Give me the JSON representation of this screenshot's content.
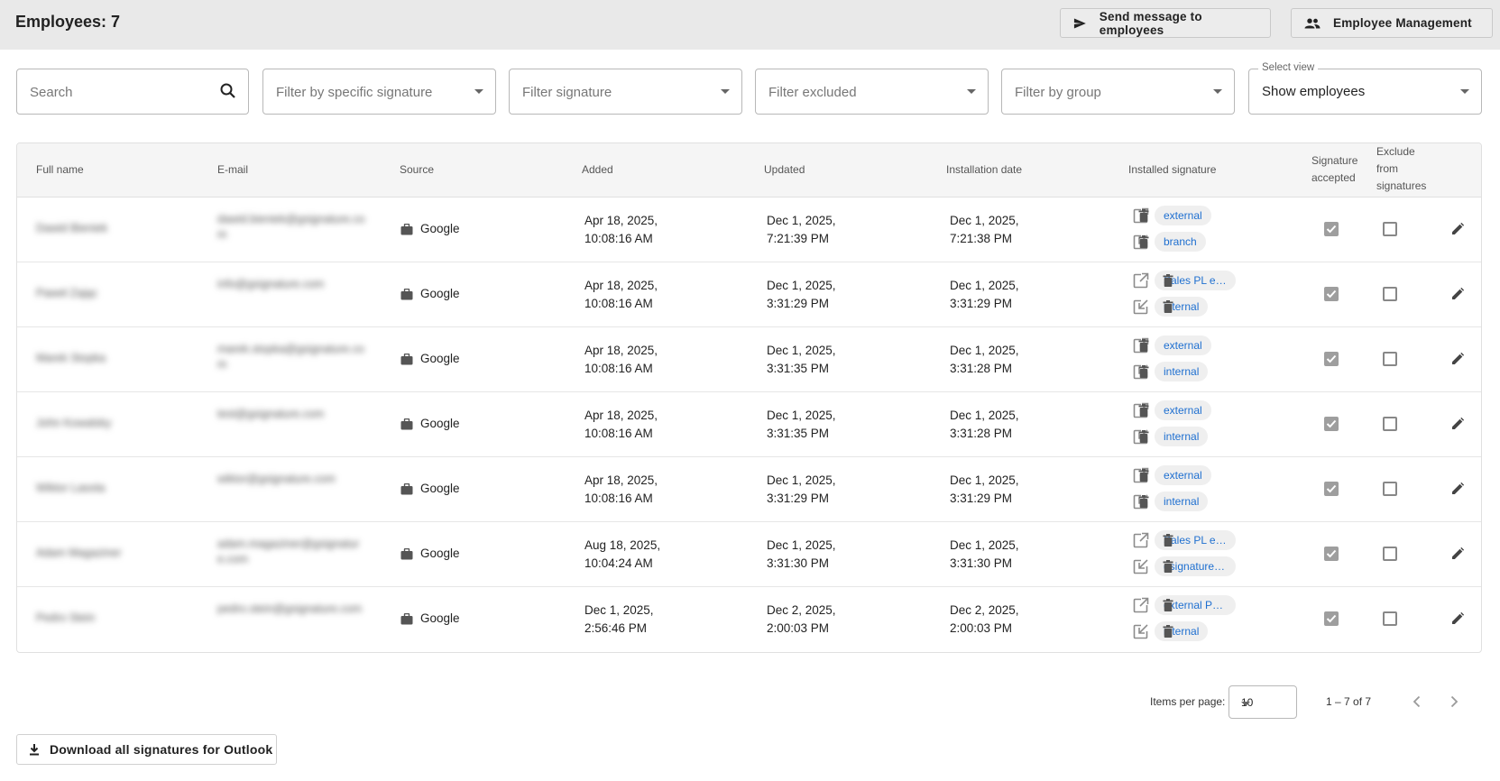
{
  "header": {
    "title": "Employees: 7",
    "send_label": "Send message to employees",
    "mgmt_label": "Employee Management"
  },
  "filters": {
    "search_placeholder": "Search",
    "specific_signature": "Filter by specific signature",
    "signature": "Filter signature",
    "excluded": "Filter excluded",
    "group": "Filter by group",
    "view_label": "Select view",
    "view_value": "Show employees"
  },
  "columns": {
    "full_name": "Full name",
    "email": "E-mail",
    "source": "Source",
    "added": "Added",
    "updated": "Updated",
    "installation_date": "Installation date",
    "installed_signature": "Installed signature",
    "signature_accepted_1": "Signature",
    "signature_accepted_2": "accepted",
    "exclude_1": "Exclude",
    "exclude_2": "from",
    "exclude_3": "signatures"
  },
  "rows": [
    {
      "name": "Dawid Bieniek",
      "email1": "dawid.bieniek@gsignature.co",
      "email2": "m",
      "source": "Google",
      "added1": "Apr 18, 2025,",
      "added2": "10:08:16 AM",
      "updated1": "Dec 1, 2025,",
      "updated2": "7:21:39 PM",
      "installed1": "Dec 1, 2025,",
      "installed2": "7:21:38 PM",
      "sig1": "external",
      "sig2": "branch",
      "accepted": true,
      "excluded": false
    },
    {
      "name": "Paweł Zając",
      "email1": "info@gsignature.com",
      "email2": "",
      "source": "Google",
      "added1": "Apr 18, 2025,",
      "added2": "10:08:16 AM",
      "updated1": "Dec 1, 2025,",
      "updated2": "3:31:29 PM",
      "installed1": "Dec 1, 2025,",
      "installed2": "3:31:29 PM",
      "sig1": "Sales PL ex...",
      "sig2": "internal",
      "accepted": true,
      "excluded": false
    },
    {
      "name": "Marek Stopka",
      "email1": "marek.stopka@gsignature.co",
      "email2": "m",
      "source": "Google",
      "added1": "Apr 18, 2025,",
      "added2": "10:08:16 AM",
      "updated1": "Dec 1, 2025,",
      "updated2": "3:31:35 PM",
      "installed1": "Dec 1, 2025,",
      "installed2": "3:31:28 PM",
      "sig1": "external",
      "sig2": "internal",
      "accepted": true,
      "excluded": false
    },
    {
      "name": "John Kowalsky",
      "email1": "test@gsignature.com",
      "email2": "",
      "source": "Google",
      "added1": "Apr 18, 2025,",
      "added2": "10:08:16 AM",
      "updated1": "Dec 1, 2025,",
      "updated2": "3:31:35 PM",
      "installed1": "Dec 1, 2025,",
      "installed2": "3:31:28 PM",
      "sig1": "external",
      "sig2": "internal",
      "accepted": true,
      "excluded": false
    },
    {
      "name": "Wiktor Lasota",
      "email1": "wiktor@gsignature.com",
      "email2": "",
      "source": "Google",
      "added1": "Apr 18, 2025,",
      "added2": "10:08:16 AM",
      "updated1": "Dec 1, 2025,",
      "updated2": "3:31:29 PM",
      "installed1": "Dec 1, 2025,",
      "installed2": "3:31:29 PM",
      "sig1": "external",
      "sig2": "internal",
      "accepted": true,
      "excluded": false
    },
    {
      "name": "Adam Magaziner",
      "email1": "adam.magaziner@gsignatur",
      "email2": "e.com",
      "source": "Google",
      "added1": "Aug 18, 2025,",
      "added2": "10:04:24 AM",
      "updated1": "Dec 1, 2025,",
      "updated2": "3:31:30 PM",
      "installed1": "Dec 1, 2025,",
      "installed2": "3:31:30 PM",
      "sig1": "Sales PL ex...",
      "sig2": "gsignaturec...",
      "accepted": true,
      "excluded": false
    },
    {
      "name": "Pedro Stein",
      "email1": "pedro.stein@gsignature.com",
      "email2": "",
      "source": "Google",
      "added1": "Dec 1, 2025,",
      "added2": "2:56:46 PM",
      "updated1": "Dec 2, 2025,",
      "updated2": "2:00:03 PM",
      "installed1": "Dec 2, 2025,",
      "installed2": "2:00:03 PM",
      "sig1": "external Pe...",
      "sig2": "internal",
      "accepted": true,
      "excluded": false
    }
  ],
  "pagination": {
    "items_label": "Items per page:",
    "items_value": "10",
    "range": "1 – 7 of 7"
  },
  "footer": {
    "download_label": "Download all signatures for Outlook"
  },
  "colors": {
    "chip_text": "#1e6fd0",
    "header_bg": "#e9e9e9"
  },
  "icons": [
    "send-icon",
    "people-icon",
    "search-icon",
    "briefcase-icon",
    "open-in-new-icon",
    "install-icon",
    "trash-icon",
    "edit-icon",
    "chevron-left-icon",
    "chevron-right-icon",
    "download-icon"
  ]
}
